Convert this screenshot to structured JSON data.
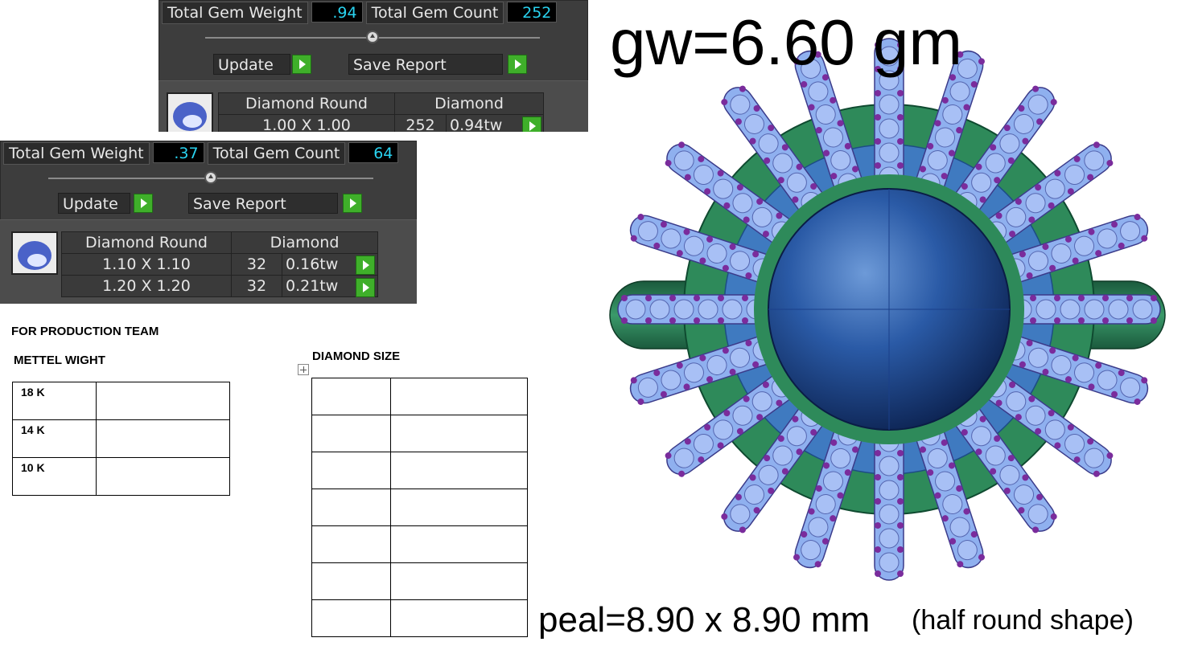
{
  "panel_a": {
    "total_weight_label": "Total Gem Weight",
    "total_weight_value": ".94",
    "total_count_label": "Total Gem Count",
    "total_count_value": "252",
    "update_label": "Update",
    "save_report_label": "Save Report",
    "header": [
      "Diamond Round",
      "Diamond"
    ],
    "rows": [
      {
        "size": "1.00 X 1.00",
        "count": "252",
        "weight": "0.94tw"
      }
    ]
  },
  "panel_b": {
    "total_weight_label": "Total Gem Weight",
    "total_weight_value": ".37",
    "total_count_label": "Total Gem Count",
    "total_count_value": "64",
    "update_label": "Update",
    "save_report_label": "Save Report",
    "header": [
      "Diamond Round",
      "Diamond"
    ],
    "rows": [
      {
        "size": "1.10 X 1.10",
        "count": "32",
        "weight": "0.16tw"
      },
      {
        "size": "1.20 X 1.20",
        "count": "32",
        "weight": "0.21tw"
      }
    ]
  },
  "annotations": {
    "gross_weight": "gw=6.60 gm",
    "pearl_size": "peal=8.90 x 8.90 mm",
    "shape_note": "(half round shape)"
  },
  "document": {
    "team_heading": "FOR PRODUCTION TEAM",
    "metal_heading": "METTEL WIGHT",
    "metal_rows": [
      "18 K",
      "14 K",
      "10 K"
    ],
    "diamond_heading": "DIAMOND SIZE"
  },
  "colors": {
    "panel_bg": "#3d3d3d",
    "value_text": "#29d3f0",
    "go_button": "#3faf2a",
    "metal_green": "#2e8a5a",
    "pearl_blue": "#1f4f95",
    "gem_light": "#8fb0ef",
    "prong_purple": "#7a2c9c"
  }
}
